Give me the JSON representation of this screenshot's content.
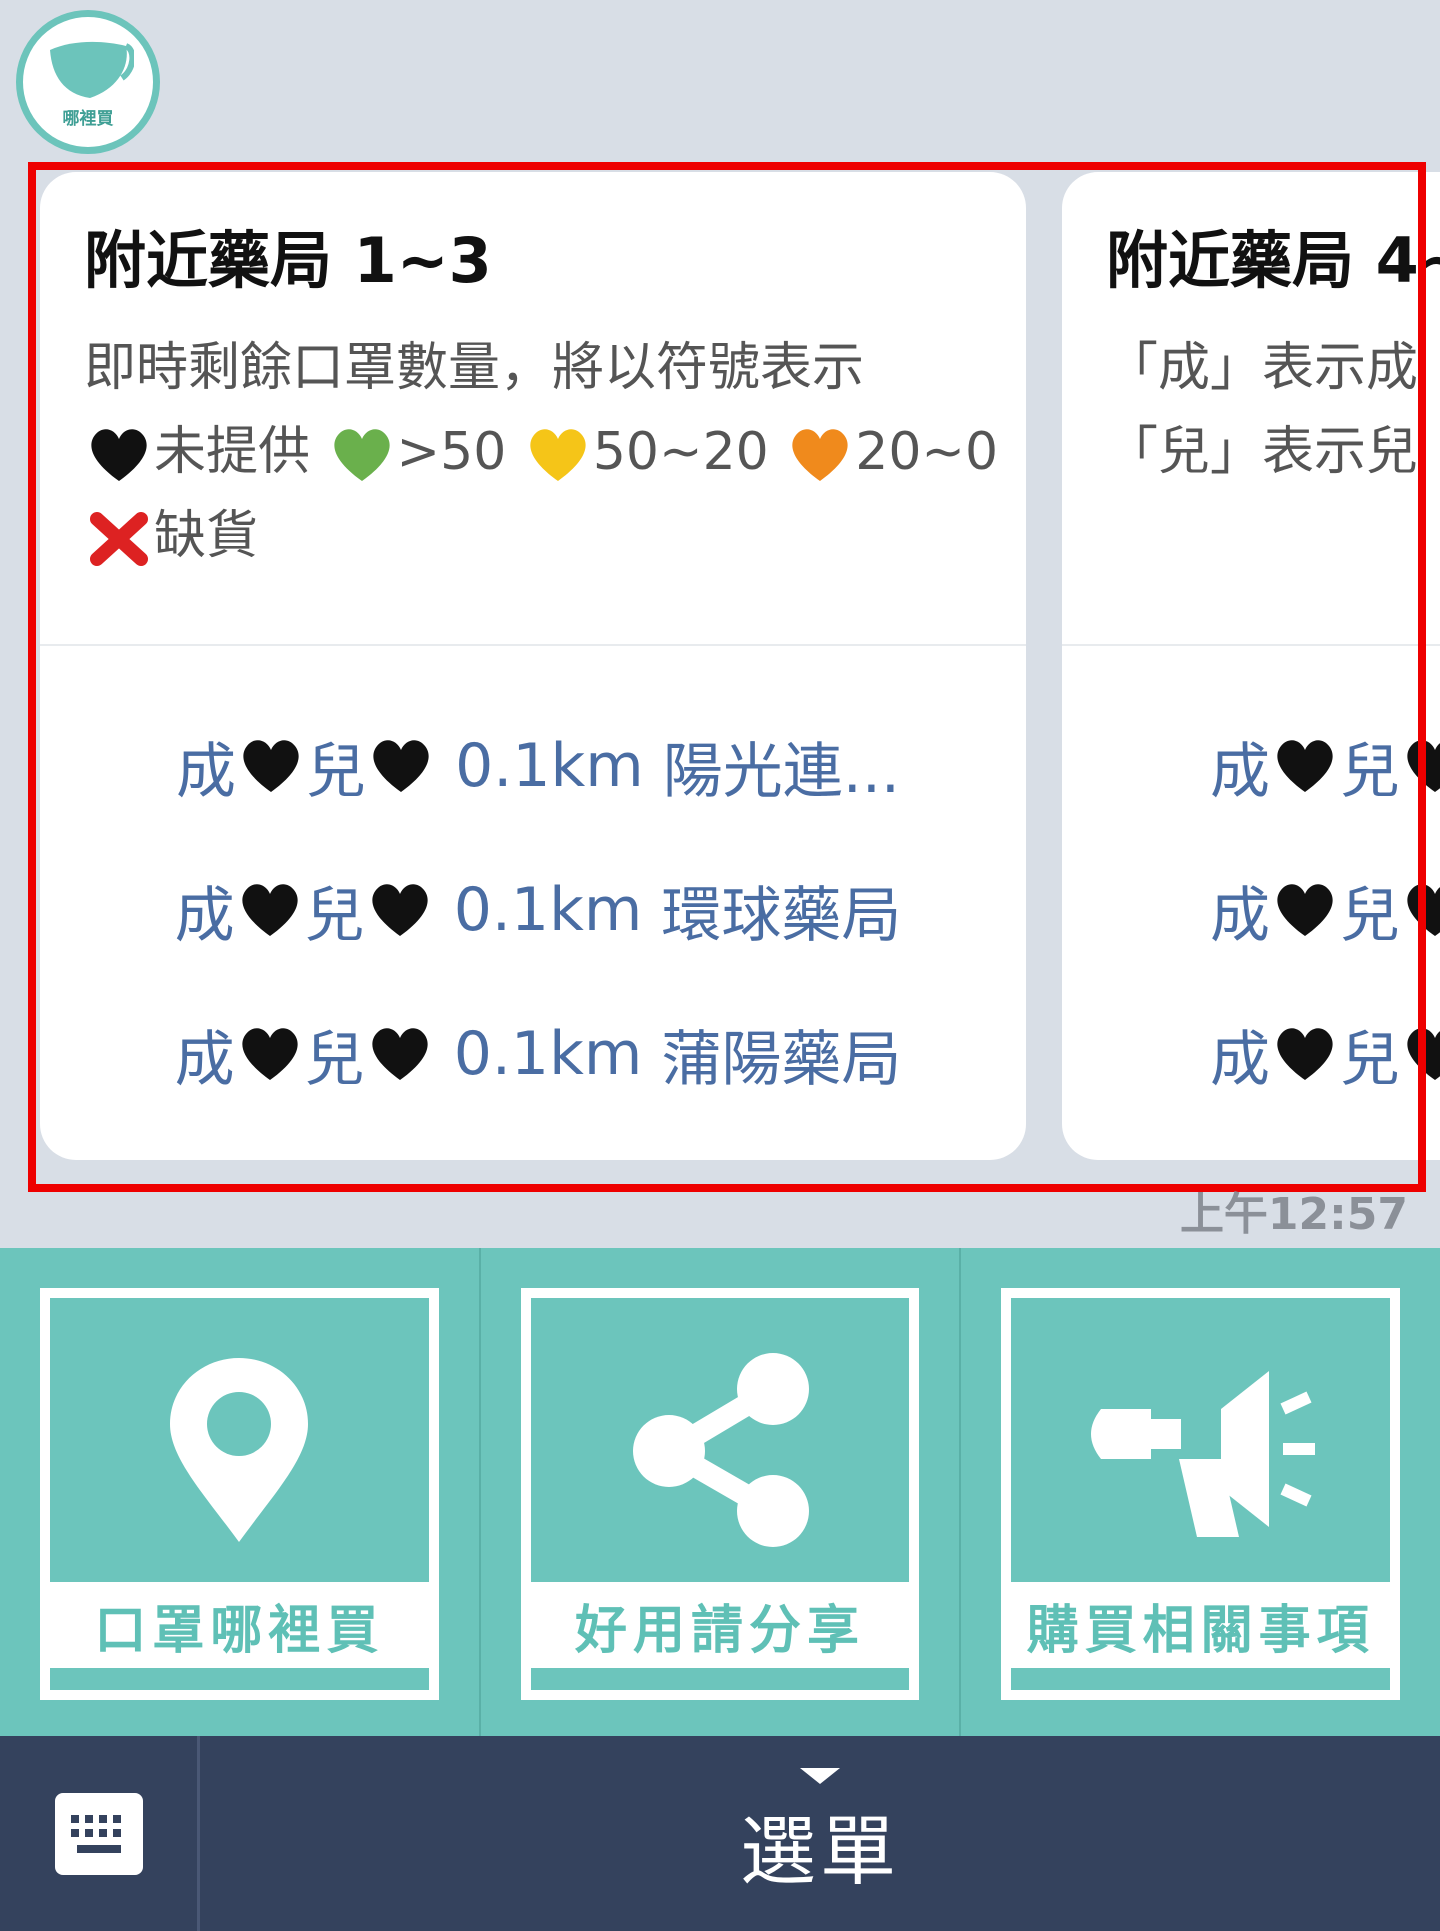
{
  "avatar": {
    "label": "哪裡買",
    "icon": "mask-icon"
  },
  "cards": [
    {
      "title": "附近藥局 1~3",
      "description_line1": "即時剩餘口罩數量，將以符號表示",
      "legend": {
        "black": "未提供",
        "green": ">50",
        "yellow": "50~20",
        "orange": "20~0",
        "cross": "缺貨"
      },
      "stores": [
        {
          "adult": "成",
          "child": "兒",
          "distance": "0.1km",
          "name": "陽光連..."
        },
        {
          "adult": "成",
          "child": "兒",
          "distance": "0.1km",
          "name": "環球藥局"
        },
        {
          "adult": "成",
          "child": "兒",
          "distance": "0.1km",
          "name": "蒲陽藥局"
        }
      ]
    },
    {
      "title": "附近藥局 4~",
      "description_line1": "「成」表示成",
      "description_line2": "「兒」表示兒",
      "stores": [
        {
          "adult": "成",
          "child": "兒"
        },
        {
          "adult": "成",
          "child": "兒"
        },
        {
          "adult": "成",
          "child": "兒"
        }
      ]
    }
  ],
  "timestamp": "上午12:57",
  "rich_menu": [
    {
      "label": "口罩哪裡買",
      "icon": "location-pin-icon"
    },
    {
      "label": "好用請分享",
      "icon": "share-icon"
    },
    {
      "label": "購買相關事項",
      "icon": "megaphone-icon"
    }
  ],
  "bottom_bar": {
    "menu_label": "選單",
    "keyboard_icon": "keyboard-icon"
  },
  "colors": {
    "teal": "#6cc5bc",
    "link_blue": "#4a6da3",
    "highlight_red": "#ee0000",
    "bar_navy": "#34425d",
    "heart_black": "#111111",
    "heart_green": "#6ab04c",
    "heart_yellow": "#f5c518",
    "heart_orange": "#f08a1c"
  }
}
